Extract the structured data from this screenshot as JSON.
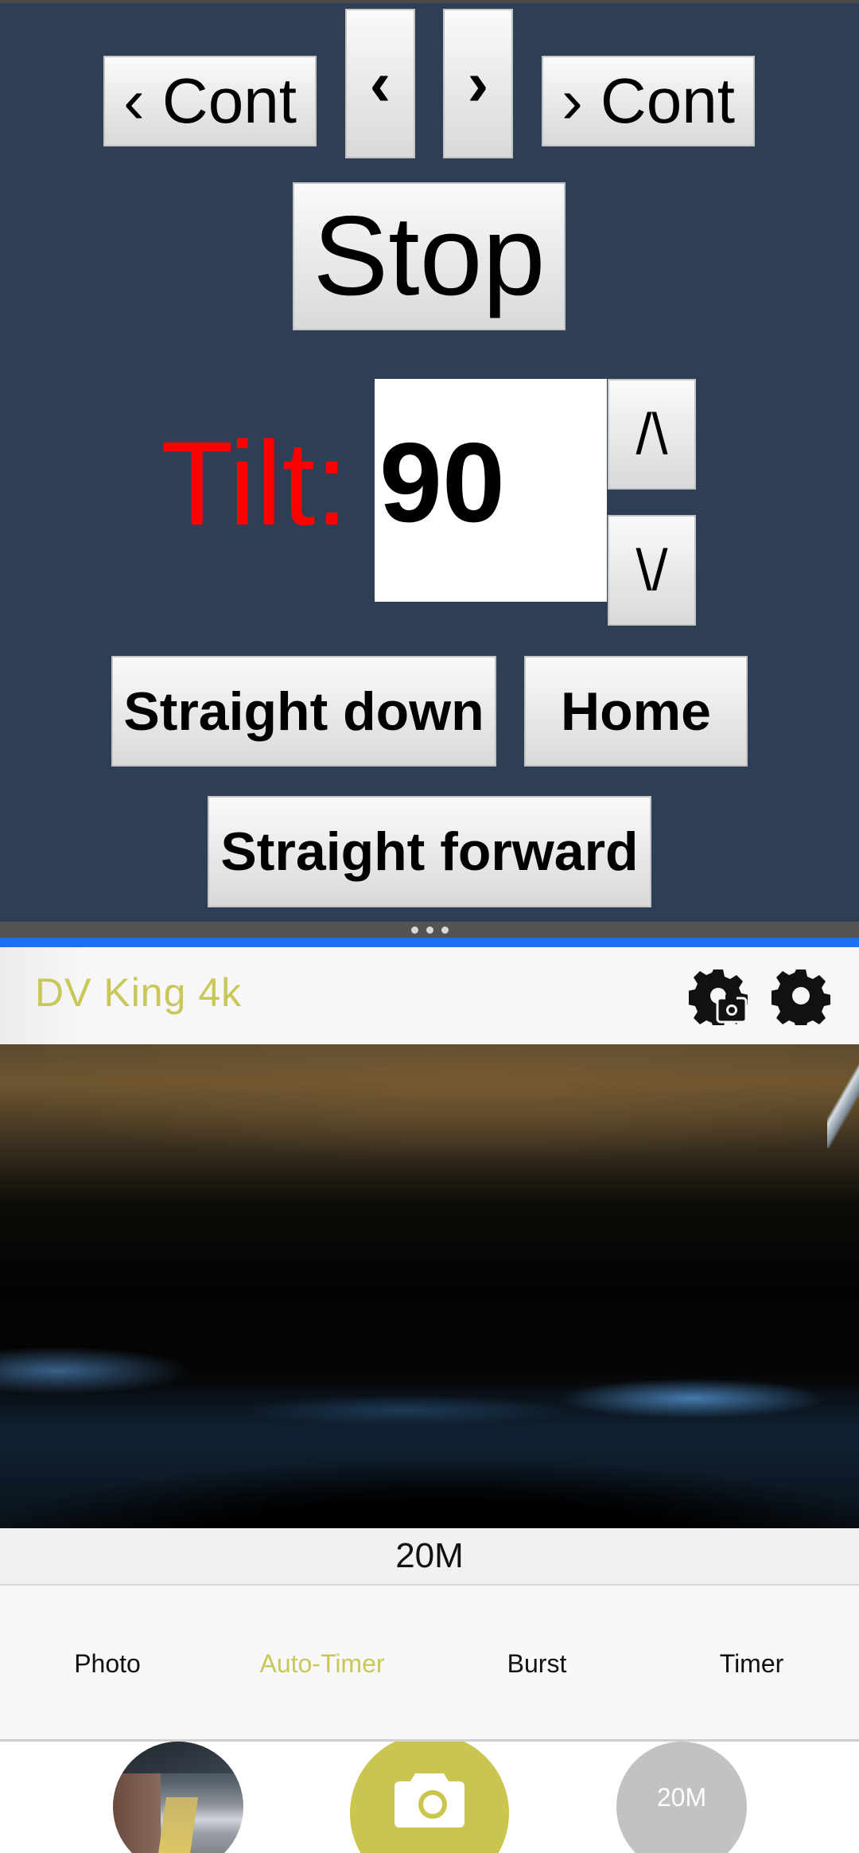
{
  "controls": {
    "cont_left_label": "‹ Cont",
    "step_left_label": "‹",
    "step_right_label": "›",
    "cont_right_label": "› Cont",
    "stop_label": "Stop",
    "tilt_label": "Tilt:",
    "tilt_value": "90",
    "tilt_up_label": "/\\",
    "tilt_down_label": "\\/",
    "straight_down_label": "Straight down",
    "home_label": "Home",
    "straight_forward_label": "Straight forward"
  },
  "camera_app": {
    "title": "DV King 4k",
    "header_icons": [
      "camera-settings-icon",
      "gear-icon"
    ],
    "resolution": "20M",
    "modes": [
      {
        "label": "Photo",
        "active": false
      },
      {
        "label": "Auto-Timer",
        "active": true
      },
      {
        "label": "Burst",
        "active": false
      },
      {
        "label": "Timer",
        "active": false
      }
    ],
    "bottom": {
      "shutter_icon": "camera-icon",
      "resolution_button": "20M"
    }
  },
  "colors": {
    "panel_bg": "#2e3f55",
    "tilt_label": "#ff0000",
    "accent": "#c9c75a",
    "divider_blue": "#1a73e8"
  }
}
